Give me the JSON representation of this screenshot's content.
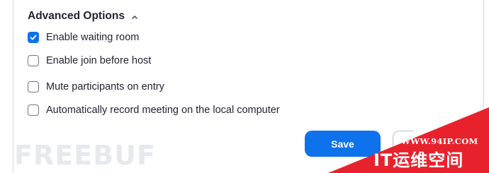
{
  "section": {
    "title": "Advanced Options"
  },
  "options": [
    {
      "label": "Enable waiting room",
      "checked": true
    },
    {
      "label": "Enable join before host",
      "checked": false
    },
    {
      "label": "Mute participants on entry",
      "checked": false
    },
    {
      "label": "Automatically record meeting on the local computer",
      "checked": false
    }
  ],
  "actions": {
    "save_label": "Save"
  },
  "watermarks": {
    "left_text": "FREEBUF",
    "right_url": "WWW.94IP.COM",
    "right_cn": "IT运维空间"
  },
  "colors": {
    "accent": "#0e72ed",
    "text": "#232333",
    "checkbox_border": "#747487",
    "watermark_red": "#e8222c"
  }
}
